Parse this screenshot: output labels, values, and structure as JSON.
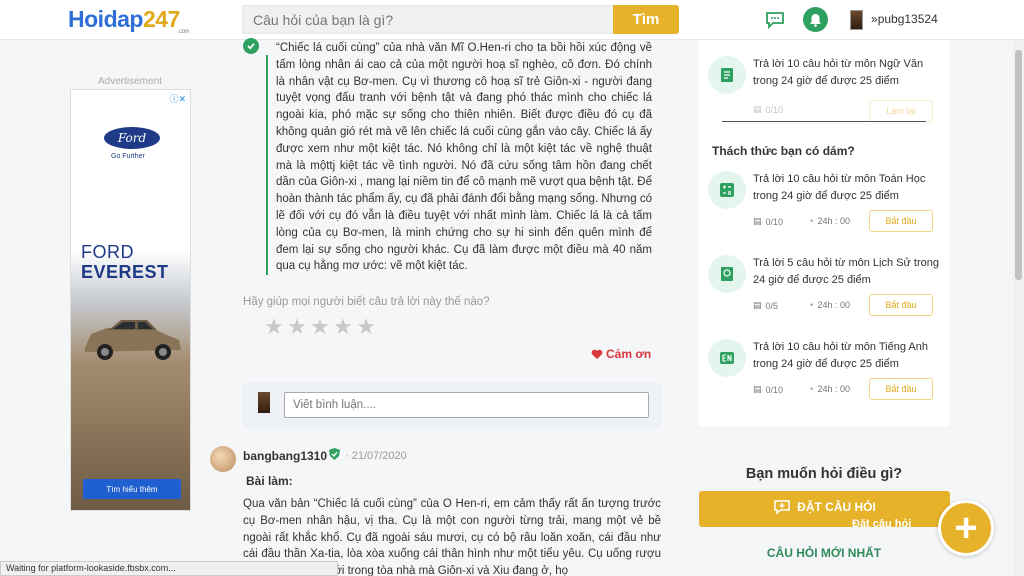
{
  "header": {
    "logo_h": "H",
    "logo_rest": "oidap",
    "logo_num": "247",
    "logo_com": ".com",
    "search_placeholder": "Câu hỏi của bạn là gì?",
    "search_button": "Tìm",
    "username": "pubg13524"
  },
  "ad": {
    "label": "Advertisement",
    "brand_logo": "Ford",
    "tagline": "Go Further",
    "line1": "FORD",
    "line2": "EVEREST",
    "cta": "Tìm hiểu thêm"
  },
  "answer1": {
    "text": "“Chiếc lá cuối cùng” của nhà văn Mĩ O.Hen-ri cho ta bồi hồi xúc động về tấm lòng nhân ái cao cả của một người hoạ sĩ nghèo, cô đơn. Đó chính là nhân vật cụ Bơ-men. Cụ vì thương cô hoạ sĩ trẻ Giôn-xi - người đang tuyệt vọng đấu tranh với bệnh tật và đang phó thác mình cho chiếc lá ngoài kia, phó mặc sự sống cho thiên nhiên. Biết được điều đó cụ đã không quản gió rét mà vẽ lên chiếc lá cuối cùng gắn vào cây. Chiếc lá ấy được xem như một kiệt tác. Nó không chỉ là một kiệt tác về nghệ thuật mà là mộttj kiệt tác về tình người. Nó đã cứu sống tâm hồn đang chết dần của Giôn-xi , mang lại niềm tin để cô mạnh mẽ vượt qua bệnh tật. Để hoàn thành tác phẩm ấy, cụ đã phải đánh đổi bằng mạng sống. Nhưng có lẽ đối với cụ đó vẫn là điều tuyệt với nhất mình làm. Chiếc lá là cả tấm lòng của cụ Bơ-men, là minh chứng cho sự hi sinh đến quên mình để đem lại sự sống cho người khác. Cụ đã làm được một điều mà 40 năm qua cụ hằng mơ ước: vẽ một kiệt tác."
  },
  "rating": {
    "prompt": "Hãy giúp mọi người biết câu trả lời này thế nào?",
    "star": "★",
    "thanks": "Cảm ơn"
  },
  "comment": {
    "placeholder": "Viết bình luận...."
  },
  "answer2": {
    "username": "bangbang1310",
    "date": "· 21/07/2020",
    "heading": "Bài làm:",
    "text": "Qua văn bản “Chiếc lá cuối cùng” của O Hen-ri, em cảm thấy rất ấn tượng trước cụ Bơ-men nhân hậu, vị tha. Cụ là một con người từng trải, mang một vẻ bề ngoài rất khắc khổ. Cụ đã ngoài sáu mươi, cụ có bộ râu loăn xoăn, cái đầu như cái đầu thần Xa-tia, lòa xòa xuống cái thân hình như một tiểu yêu. Cụ uống rượu ... sống ở tầng dưới trong tòa nhà mà Giôn-xi và Xiu đang ở, họ"
  },
  "status_bar": "Waiting for platform-lookaside.fbsbx.com...",
  "challenges_top": {
    "title": "Trả lời 10 câu hỏi  từ môn Ngữ Văn trong 24 giờ để được 25 điểm",
    "count": "0/10",
    "button": "Làm lại"
  },
  "challenge_heading": "Thách thức bạn có dám?",
  "challenges": [
    {
      "title": "Trả lời 10 câu hỏi  từ môn Toán Học trong 24 giờ để được 25 điểm",
      "count": "0/10",
      "time": "24h : 00",
      "button": "Bắt đầu"
    },
    {
      "title": "Trả lời 5 câu hỏi  từ môn Lịch Sử trong 24 giờ để được 25 điểm",
      "count": "0/5",
      "time": "24h : 00",
      "button": "Bắt đầu"
    },
    {
      "title": "Trả lời 10 câu hỏi  từ môn Tiếng Anh trong 24 giờ để được 25 điểm",
      "count": "0/10",
      "time": "24h : 00",
      "button": "Bắt đầu"
    }
  ],
  "ask": {
    "title": "Bạn muốn hỏi điều gì?",
    "button": "ĐẶT CÂU HỎI",
    "subtext": "Đặt câu hỏi",
    "plus": "+"
  },
  "new_questions": "CÂU HỎI MỚI NHẤT",
  "colors": {
    "brand_yellow": "#e6b22a",
    "brand_green": "#2ea05f",
    "brand_blue": "#2f6fd6"
  }
}
